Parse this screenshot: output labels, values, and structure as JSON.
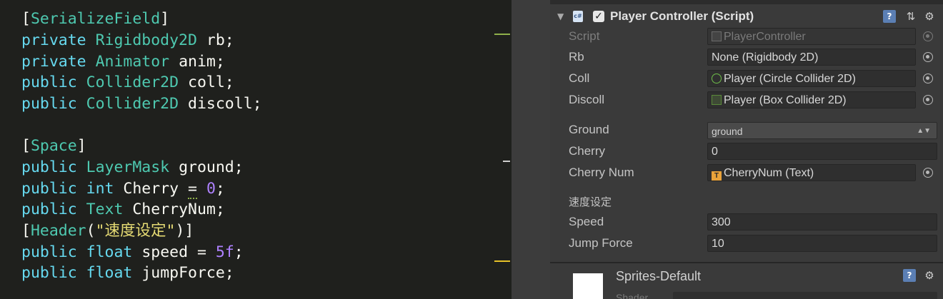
{
  "editor": {
    "lines": [
      {
        "a": "[",
        "b": "SerializeField",
        "c": "]"
      },
      {
        "kw": "private",
        "ty": "Rigidbody2D",
        "id": "rb;"
      },
      {
        "kw": "private",
        "ty": "Animator",
        "id": "anim;"
      },
      {
        "kw": "public",
        "ty": "Collider2D",
        "id": "coll;"
      },
      {
        "kw": "public",
        "ty": "Collider2D",
        "id": "discoll;"
      },
      {
        "a": "[",
        "b": "Space",
        "c": "]"
      },
      {
        "kw": "public",
        "ty": "LayerMask",
        "id": "ground;"
      },
      {
        "kw": "public",
        "ty": "int",
        "id": "Cherry",
        "op": "=",
        "num": "0",
        "end": ";"
      },
      {
        "kw": "public",
        "ty": "Text",
        "id": "CherryNum;"
      },
      {
        "a": "[",
        "b": "Header",
        "c": "(",
        "st": "\"速度设定\"",
        "d": ")]"
      },
      {
        "kw": "public",
        "ty": "float",
        "id": "speed",
        "op": "=",
        "num": "5f",
        "end": ";"
      },
      {
        "kw": "public",
        "ty": "float",
        "id": "jumpForce;"
      }
    ]
  },
  "inspector": {
    "component_title": "Player Controller (Script)",
    "fields": {
      "script": {
        "label": "Script",
        "value": "PlayerController"
      },
      "rb": {
        "label": "Rb",
        "value": "None (Rigidbody 2D)"
      },
      "coll": {
        "label": "Coll",
        "value": "Player (Circle Collider 2D)"
      },
      "discoll": {
        "label": "Discoll",
        "value": "Player (Box Collider 2D)"
      },
      "ground": {
        "label": "Ground",
        "value": "ground"
      },
      "cherry": {
        "label": "Cherry",
        "value": "0"
      },
      "cherry_num": {
        "label": "Cherry Num",
        "value": "CherryNum (Text)"
      },
      "header": "速度设定",
      "speed": {
        "label": "Speed",
        "value": "300"
      },
      "jump_force": {
        "label": "Jump Force",
        "value": "10"
      }
    },
    "material": {
      "title": "Sprites-Default",
      "shader_label": "Shader"
    }
  },
  "colors": {
    "gutter_green": "#8fb04a",
    "gutter_yellow": "#e6c229",
    "accent_blue": "#5b7fb4"
  }
}
